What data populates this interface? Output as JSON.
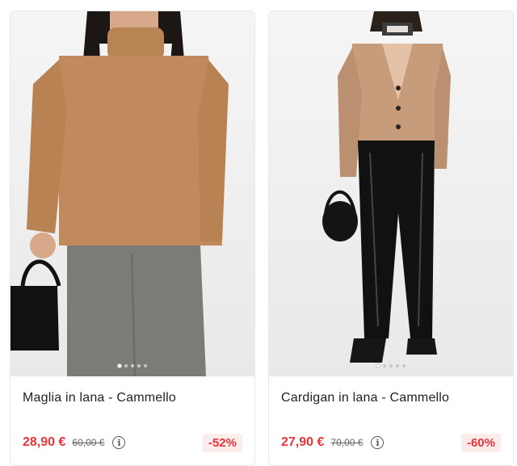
{
  "products": [
    {
      "name": "Maglia in lana - Cammello",
      "price": "28,90 €",
      "old_price": "60,00 €",
      "discount": "-52%",
      "active_image": 1,
      "image_count": 5
    },
    {
      "name": "Cardigan in lana - Cammello",
      "price": "27,90 €",
      "old_price": "70,00 €",
      "discount": "-60%",
      "active_image": 1,
      "image_count": 5
    }
  ],
  "info_icon": "info-icon",
  "colors": {
    "price": "#e8343a",
    "discount_bg": "#fdecec",
    "sweater": "#c08a5c",
    "cardigan": "#c69c7b"
  }
}
